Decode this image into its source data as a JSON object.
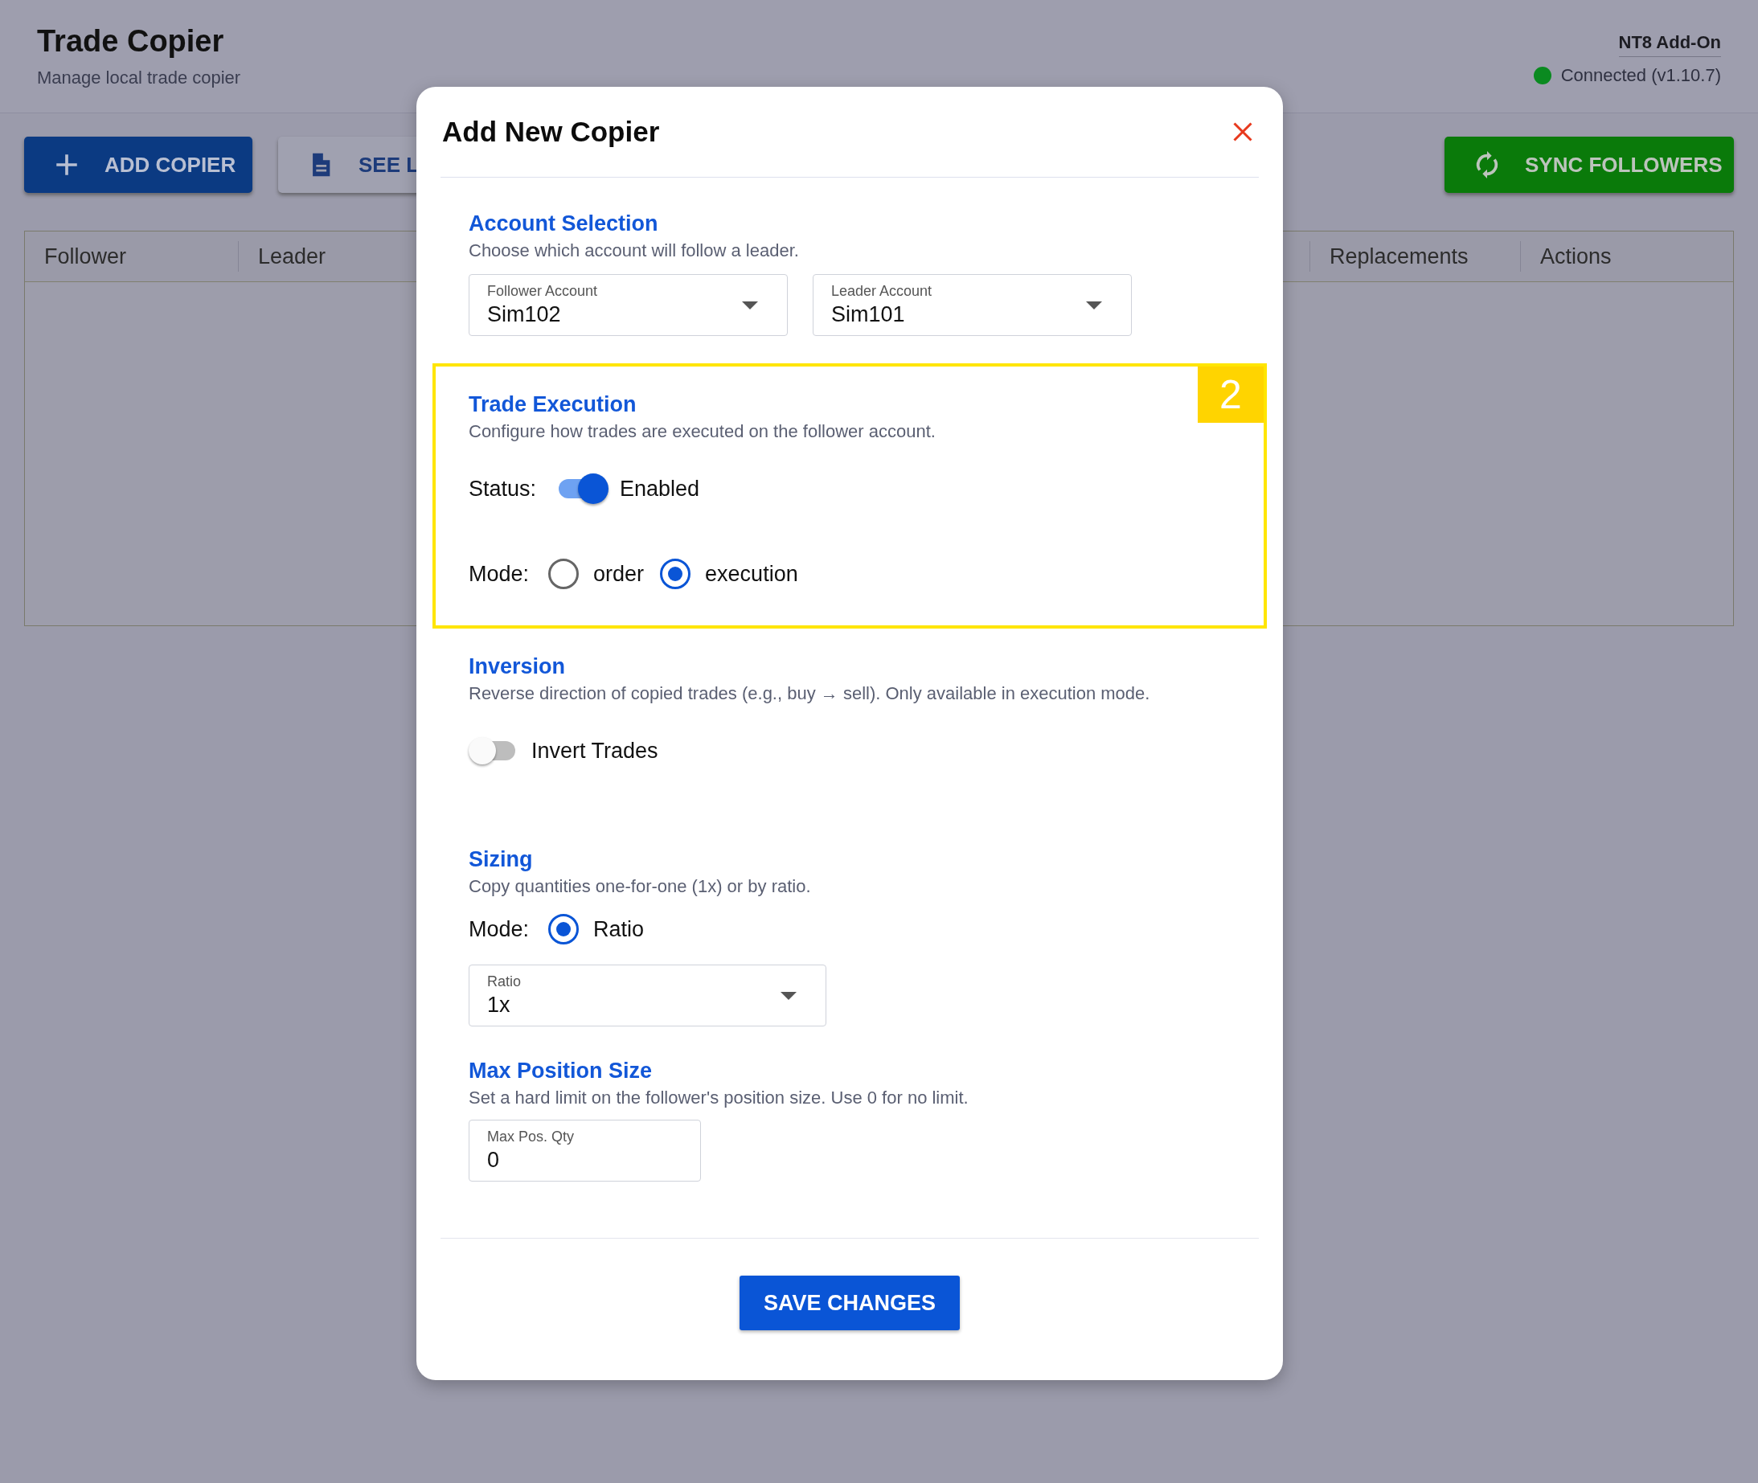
{
  "app": {
    "title": "Trade Copier",
    "subtitle": "Manage local trade copier",
    "addon_label": "NT8 Add-On",
    "connection": {
      "connected": true,
      "text": "Connected (v1.10.7)"
    }
  },
  "toolbar": [
    {
      "kind": "primary",
      "label": "ADD COPIER"
    },
    {
      "kind": "outline",
      "label": "SEE L"
    },
    {
      "kind": "success",
      "label": "SYNC FOLLOWERS"
    }
  ],
  "table": {
    "columns": [
      "Follower",
      "Leader",
      "Replacements",
      "Actions"
    ]
  },
  "dialog": {
    "title": "Add New Copier",
    "sections": [
      {
        "title": "Account Selection",
        "description": "Choose which account will follow a leader.",
        "selects": [
          {
            "label": "Follower Account",
            "value": "Sim102"
          },
          {
            "label": "Leader Account",
            "value": "Sim101"
          }
        ]
      },
      {
        "title": "Trade Execution",
        "description": "Configure how trades are executed on the follower account.",
        "highlight": "2",
        "status": {
          "label": "Status:",
          "on": true,
          "text": "Enabled"
        },
        "mode": {
          "label": "Mode:",
          "options": [
            {
              "label": "order",
              "selected": false
            },
            {
              "label": "execution",
              "selected": true
            }
          ]
        }
      },
      {
        "title": "Inversion",
        "description": "Reverse direction of copied trades (e.g., buy → sell). Only available in execution mode.",
        "toggle": {
          "on": false,
          "text": "Invert Trades"
        }
      },
      {
        "title": "Sizing",
        "description": "Copy quantities one-for-one (1x) or by ratio.",
        "mode": {
          "label": "Mode:",
          "options": [
            {
              "label": "Ratio",
              "selected": true
            }
          ]
        },
        "select": {
          "label": "Ratio",
          "value": "1x"
        }
      },
      {
        "title": "Max Position Size",
        "description": "Set a hard limit on the follower's position size. Use 0 for no limit.",
        "field": {
          "label": "Max Pos. Qty",
          "value": "0"
        }
      }
    ],
    "save_label": "SAVE CHANGES"
  }
}
